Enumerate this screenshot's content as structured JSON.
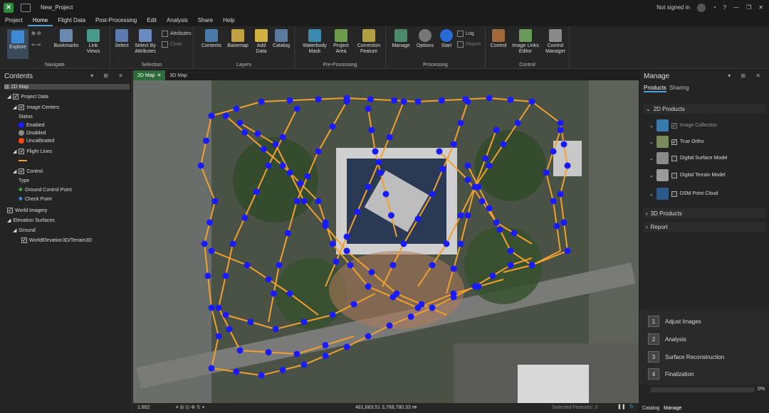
{
  "window": {
    "title": "New_Project",
    "signin": "Not signed in"
  },
  "menu": [
    "Project",
    "Home",
    "Flight Data",
    "Post-Processing",
    "Edit",
    "Analysis",
    "Share",
    "Help"
  ],
  "ribbon": {
    "navigate": {
      "label": "Navigate",
      "explore": "Explore",
      "bookmarks": "Bookmarks",
      "link_views": "Link Views"
    },
    "selection": {
      "label": "Selection",
      "select": "Select",
      "select_by_attr": "Select By Attributes",
      "attributes": "Attributes",
      "clear": "Clear"
    },
    "layers": {
      "label": "Layers",
      "contents": "Contents",
      "basemap": "Basemap",
      "add_data": "Add Data",
      "catalog": "Catalog"
    },
    "preprocessing": {
      "label": "Pre-Processing",
      "waterbody": "Waterbody Mask",
      "project_area": "Project Area",
      "correction": "Correction Feature"
    },
    "processing": {
      "label": "Processing",
      "manage": "Manage",
      "options": "Options",
      "start": "Start",
      "log": "Log",
      "report": "Report"
    },
    "control": {
      "label": "Control",
      "control": "Control",
      "image_links": "Image Links Editor",
      "control_manager": "Control Manager"
    }
  },
  "contents": {
    "title": "Contents",
    "map2d": "2D Map",
    "project_data": "Project Data",
    "image_centers": "Image Centers",
    "status": "Status",
    "enabled": "Enabled",
    "disabled": "Disabled",
    "uncalibrated": "Uncalibrated",
    "flight_lines": "Flight Lines",
    "control": "Control",
    "type": "Type",
    "gcp": "Ground Control Point",
    "check_point": "Check Point",
    "world_imagery": "World Imagery",
    "elevation_surfaces": "Elevation Surfaces",
    "ground": "Ground",
    "terrain": "WorldElevation3D/Terrain3D"
  },
  "map_tabs": [
    "2D Map",
    "3D Map"
  ],
  "status_bar": {
    "scale": "1:892",
    "coords": "481,663.51 3,768,780.33 m",
    "selected": "Selected Features: 0"
  },
  "manage": {
    "title": "Manage",
    "tabs": [
      "Products",
      "Sharing"
    ],
    "products_2d": "2D Products",
    "products": [
      "Image Collection",
      "True Ortho",
      "Digital Surface Model",
      "Digital Terrain Model",
      "DSM Point Cloud"
    ],
    "products_3d": "3D Products",
    "report": "Report",
    "steps": [
      "Adjust Images",
      "Analysis",
      "Surface Reconstruction",
      "Finalization"
    ],
    "step_nums": [
      "1",
      "2",
      "3",
      "4"
    ],
    "progress": "0%",
    "bottom_tabs": [
      "Catalog",
      "Manage"
    ]
  },
  "colors": {
    "enabled": "#1a1aff",
    "disabled": "#8a8a8a",
    "uncalibrated": "#ff4a10",
    "flight_line": "#f0a030",
    "accent": "#4aa3df"
  }
}
